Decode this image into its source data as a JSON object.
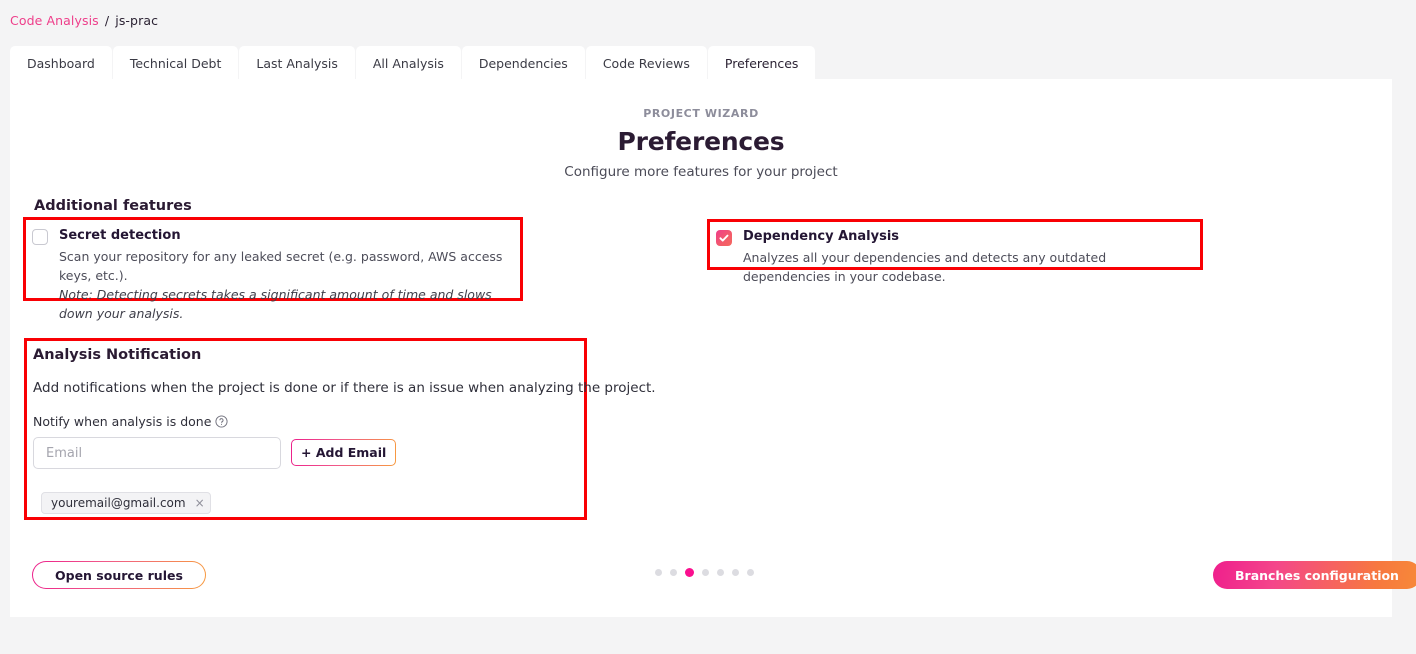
{
  "breadcrumb": {
    "link": "Code Analysis",
    "separator": "/",
    "current": "js-prac",
    "link_color": "#ee3e8a"
  },
  "tabs": [
    {
      "label": "Dashboard",
      "active": false
    },
    {
      "label": "Technical Debt",
      "active": false
    },
    {
      "label": "Last Analysis",
      "active": false
    },
    {
      "label": "All Analysis",
      "active": false
    },
    {
      "label": "Dependencies",
      "active": false
    },
    {
      "label": "Code Reviews",
      "active": false
    },
    {
      "label": "Preferences",
      "active": true
    }
  ],
  "wizard": {
    "eyebrow": "PROJECT WIZARD",
    "title": "Preferences",
    "subtitle": "Configure more features for your project"
  },
  "additional_features": {
    "title": "Additional features",
    "secret_detection": {
      "checkbox_icon": "checkbox-unchecked-icon",
      "checked": false,
      "title": "Secret detection",
      "description": "Scan your repository for any leaked secret (e.g. password, AWS access keys, etc.).",
      "note": "Note: Detecting secrets takes a significant amount of time and slows down your analysis."
    },
    "dependency_analysis": {
      "checkbox_icon": "checkbox-checked-icon",
      "checked": true,
      "title": "Dependency Analysis",
      "description": "Analyzes all your dependencies and detects any outdated dependencies in your codebase."
    }
  },
  "analysis_notification": {
    "title": "Analysis Notification",
    "description": "Add notifications when the project is done or if there is an issue when analyzing the project.",
    "notify_label": "Notify when analysis is done",
    "help_icon": "question-circle-icon",
    "email_input": {
      "value": "",
      "placeholder": "Email"
    },
    "add_email_button": "+ Add Email",
    "email_chips": [
      {
        "email": "youremail@gmail.com",
        "remove_icon": "close-icon",
        "remove_label": "×"
      }
    ]
  },
  "footer": {
    "open_source_rules_button": "Open source rules",
    "branches_configuration_button": "Branches configuration",
    "pagination": {
      "total": 7,
      "active_index": 3,
      "active_color": "#fa0f8f",
      "inactive_color": "#dcdce1"
    }
  },
  "highlights": {
    "color": "#f90004",
    "boxes": [
      "secret-detection",
      "dependency-analysis",
      "analysis-notification"
    ]
  }
}
